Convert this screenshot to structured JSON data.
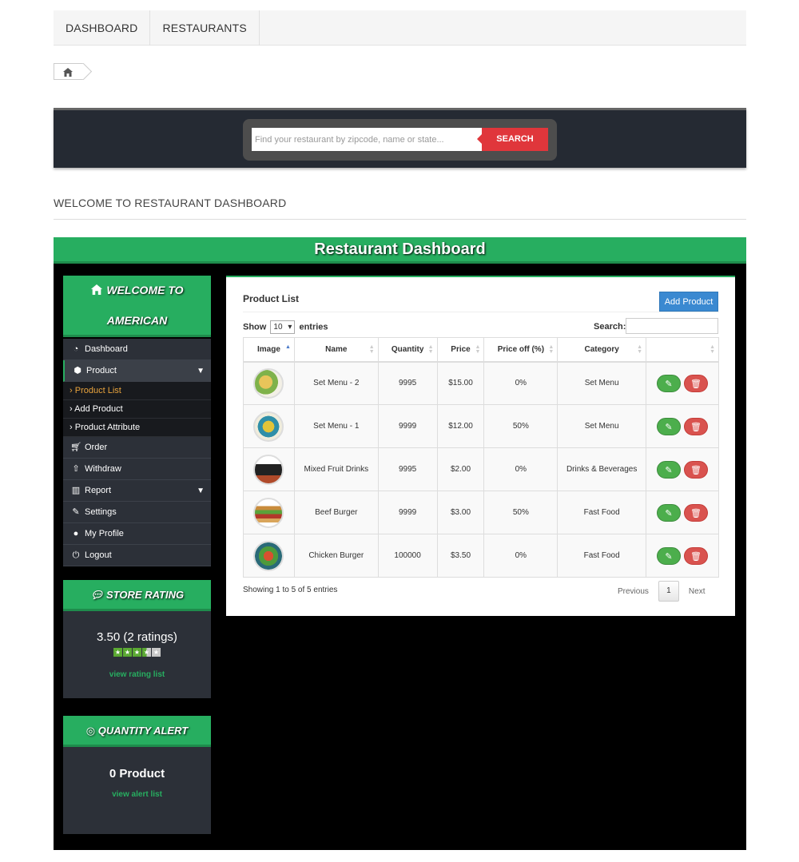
{
  "topnav": {
    "items": [
      "DASHBOARD",
      "RESTAURANTS"
    ]
  },
  "search": {
    "placeholder": "Find your restaurant by zipcode, name or state...",
    "button": "SEARCH"
  },
  "welcome_title": "WELCOME TO RESTAURANT DASHBOARD",
  "dashboard": {
    "title": "Restaurant Dashboard",
    "sidebar": {
      "welcome_line1": "WELCOME TO",
      "welcome_line2": "AMERICAN",
      "menu": [
        {
          "label": "Dashboard",
          "icon": "dashboard-icon"
        },
        {
          "label": "Product",
          "icon": "tags-icon"
        },
        {
          "label": "Order",
          "icon": "cart-icon"
        },
        {
          "label": "Withdraw",
          "icon": "upload-icon"
        },
        {
          "label": "Report",
          "icon": "bar-chart-icon"
        },
        {
          "label": "Settings",
          "icon": "wrench-icon"
        },
        {
          "label": "My Profile",
          "icon": "user-icon"
        },
        {
          "label": "Logout",
          "icon": "power-icon"
        }
      ],
      "submenu": [
        "Product List",
        "Add Product",
        "Product Attribute"
      ]
    },
    "store_rating": {
      "title": "STORE RATING",
      "value": "3.50 (2 ratings)",
      "stars_filled": 3.5,
      "stars_total": 5,
      "link": "view rating list"
    },
    "quantity_alert": {
      "title": "QUANTITY ALERT",
      "value": "0 Product",
      "link": "view alert list"
    }
  },
  "product_list": {
    "title": "Product List",
    "add_button": "Add Product",
    "show_label": "Show",
    "entries_value": "10",
    "entries_label": "entries",
    "search_label": "Search:",
    "columns": [
      "Image",
      "Name",
      "Quantity",
      "Price",
      "Price off (%)",
      "Category",
      ""
    ],
    "rows": [
      {
        "name": "Set Menu - 2",
        "quantity": "9995",
        "price": "$15.00",
        "price_off": "0%",
        "category": "Set Menu"
      },
      {
        "name": "Set Menu - 1",
        "quantity": "9999",
        "price": "$12.00",
        "price_off": "50%",
        "category": "Set Menu"
      },
      {
        "name": "Mixed Fruit Drinks",
        "quantity": "9995",
        "price": "$2.00",
        "price_off": "0%",
        "category": "Drinks & Beverages"
      },
      {
        "name": "Beef Burger",
        "quantity": "9999",
        "price": "$3.00",
        "price_off": "50%",
        "category": "Fast Food"
      },
      {
        "name": "Chicken Burger",
        "quantity": "100000",
        "price": "$3.50",
        "price_off": "0%",
        "category": "Fast Food"
      }
    ],
    "showing": "Showing 1 to 5 of 5 entries",
    "pager": {
      "prev": "Previous",
      "page": "1",
      "next": "Next"
    }
  },
  "colors": {
    "green": "#27ae60",
    "red": "#e0363b",
    "blue": "#3a89d1",
    "dark": "#2c3038",
    "accent": "#e8a33d"
  }
}
